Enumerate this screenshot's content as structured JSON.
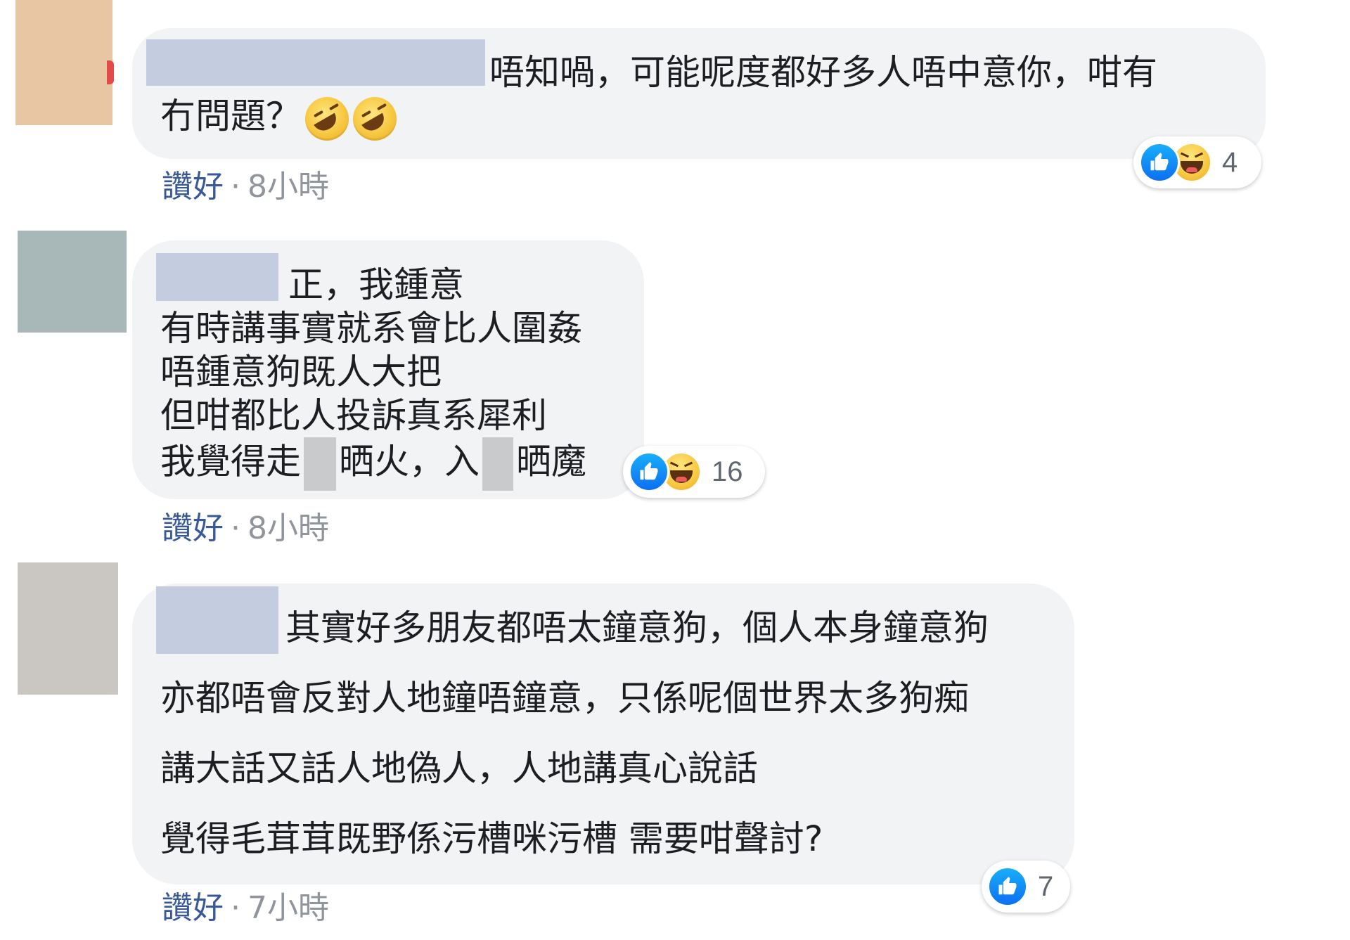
{
  "colors": {
    "bubble_bg": "#f2f3f5",
    "link": "#385898",
    "meta": "#90949c",
    "like_blue": "#1877f2",
    "redaction": "#c4cde0"
  },
  "comments": [
    {
      "avatar_color": "#e8c6a3",
      "lines": [
        "唔知喎，可能呢度都好多人唔中意你，咁有",
        "冇問題？"
      ],
      "emoji": [
        "rolling-on-floor-laughing",
        "rolling-on-floor-laughing"
      ],
      "reactions": {
        "icons": [
          "like-icon",
          "haha-icon"
        ],
        "count": "4"
      },
      "like_label": "讚好",
      "separator": "·",
      "time": "8小時"
    },
    {
      "avatar_color": "#a8b8b8",
      "lines": [
        "正，我鍾意",
        "有時講事實就系會比人圍姦",
        "唔鍾意狗既人大把",
        "但咁都比人投訴真系犀利",
        "我覺得走",
        "晒火，入",
        "晒魔"
      ],
      "reactions": {
        "icons": [
          "like-icon",
          "haha-icon"
        ],
        "count": "16"
      },
      "like_label": "讚好",
      "separator": "·",
      "time": "8小時"
    },
    {
      "avatar_color": "#cac6c2",
      "lines": [
        "其實好多朋友都唔太鐘意狗，個人本身鐘意狗",
        "亦都唔會反對人地鐘唔鐘意，只係呢個世界太多狗痴",
        "講大話又話人地偽人，人地講真心說話",
        "覺得毛茸茸既野係污槽咪污槽 需要咁聲討?"
      ],
      "reactions": {
        "icons": [
          "like-icon"
        ],
        "count": "7"
      },
      "like_label": "讚好",
      "separator": "·",
      "time": "7小時"
    }
  ]
}
